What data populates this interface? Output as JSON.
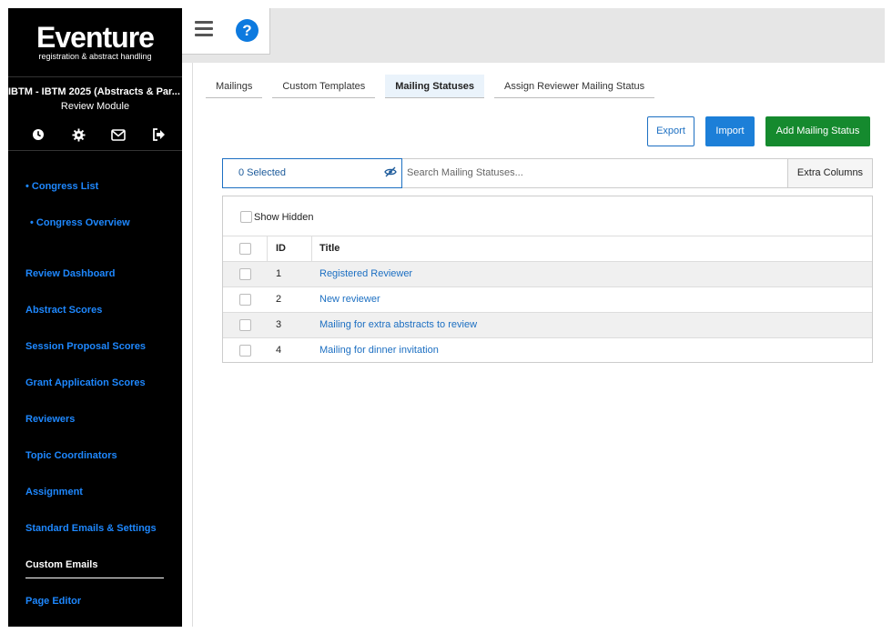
{
  "logo": {
    "name": "Eventure",
    "tagline": "registration & abstract handling"
  },
  "sidebar": {
    "congress_title": "IBTM - IBTM 2025 (Abstracts & Par...",
    "module": "Review Module",
    "icons": [
      "clock-icon",
      "gear-icon",
      "mail-icon",
      "logout-icon"
    ],
    "links": [
      "• Congress List",
      "• Congress Overview"
    ],
    "items": [
      "Review Dashboard",
      "Abstract Scores",
      "Session Proposal Scores",
      "Grant Application Scores",
      "Reviewers",
      "Topic Coordinators",
      "Assignment",
      "Standard Emails & Settings",
      "Custom Emails",
      "Page Editor"
    ],
    "current_item": "Custom Emails"
  },
  "topbar": {
    "menu_icon": "hamburger-icon",
    "help_icon": "question-icon",
    "help_glyph": "?"
  },
  "tabs": [
    "Mailings",
    "Custom Templates",
    "Mailing Statuses",
    "Assign Reviewer Mailing Status"
  ],
  "active_tab": "Mailing Statuses",
  "actions": {
    "export": "Export",
    "import": "Import",
    "add": "Add Mailing Status"
  },
  "filter": {
    "selected": "0 Selected",
    "search_placeholder": "Search Mailing Statuses...",
    "extra_columns": "Extra Columns"
  },
  "table": {
    "show_hidden": "Show Hidden",
    "columns": {
      "id": "ID",
      "title": "Title"
    },
    "rows": [
      {
        "id": "1",
        "title": "Registered Reviewer"
      },
      {
        "id": "2",
        "title": "New reviewer"
      },
      {
        "id": "3",
        "title": "Mailing for extra abstracts to review"
      },
      {
        "id": "4",
        "title": "Mailing for dinner invitation"
      }
    ]
  },
  "colors": {
    "sidebar_bg": "#000000",
    "link": "#1e88ff",
    "primary": "#1c7fd8",
    "success": "#158a2e"
  }
}
